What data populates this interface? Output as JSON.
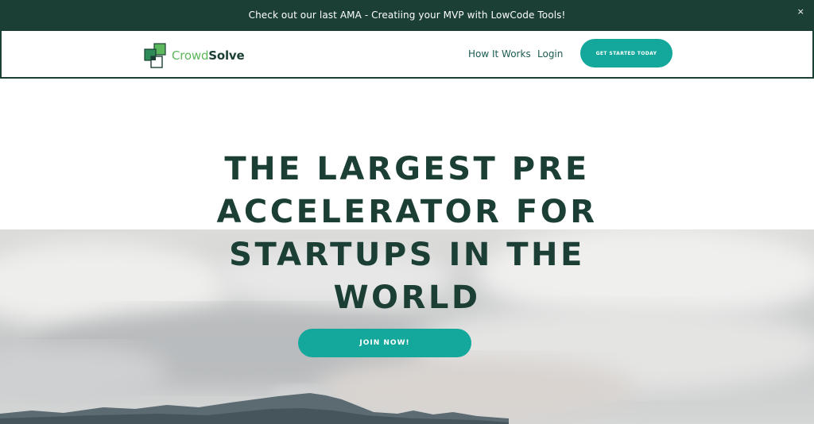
{
  "announcement": {
    "text": "Check out our last AMA - Creatiing your MVP with LowCode Tools!",
    "close_icon": "close-icon",
    "close_glyph": "×"
  },
  "nav": {
    "logo_icon": "overlapping-squares-logo-icon",
    "brand_part1": "Crowd",
    "brand_part2": "Solve",
    "links": [
      "How It Works",
      "Login"
    ],
    "cta_label": "GET STARTED TODAY"
  },
  "hero": {
    "headline_lines": [
      "THE LARGEST PRE",
      "ACCELERATOR FOR",
      "STARTUPS IN THE",
      "WORLD"
    ],
    "join_label": "JOIN NOW!"
  },
  "colors": {
    "dark_green": "#1b3f35",
    "teal": "#14a89c",
    "logo_green": "#5cb85c"
  }
}
